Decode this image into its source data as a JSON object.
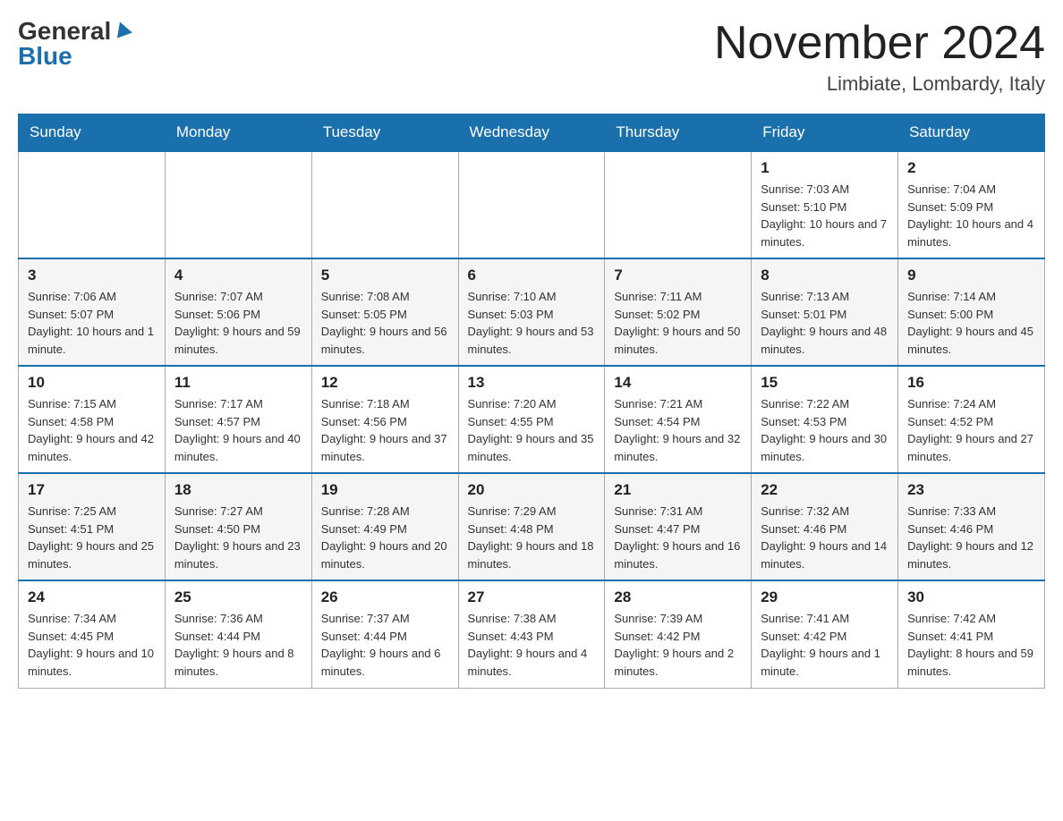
{
  "logo": {
    "general": "General",
    "blue": "Blue"
  },
  "title": "November 2024",
  "location": "Limbiate, Lombardy, Italy",
  "days_of_week": [
    "Sunday",
    "Monday",
    "Tuesday",
    "Wednesday",
    "Thursday",
    "Friday",
    "Saturday"
  ],
  "weeks": [
    [
      {
        "day": "",
        "info": ""
      },
      {
        "day": "",
        "info": ""
      },
      {
        "day": "",
        "info": ""
      },
      {
        "day": "",
        "info": ""
      },
      {
        "day": "",
        "info": ""
      },
      {
        "day": "1",
        "info": "Sunrise: 7:03 AM\nSunset: 5:10 PM\nDaylight: 10 hours and 7 minutes."
      },
      {
        "day": "2",
        "info": "Sunrise: 7:04 AM\nSunset: 5:09 PM\nDaylight: 10 hours and 4 minutes."
      }
    ],
    [
      {
        "day": "3",
        "info": "Sunrise: 7:06 AM\nSunset: 5:07 PM\nDaylight: 10 hours and 1 minute."
      },
      {
        "day": "4",
        "info": "Sunrise: 7:07 AM\nSunset: 5:06 PM\nDaylight: 9 hours and 59 minutes."
      },
      {
        "day": "5",
        "info": "Sunrise: 7:08 AM\nSunset: 5:05 PM\nDaylight: 9 hours and 56 minutes."
      },
      {
        "day": "6",
        "info": "Sunrise: 7:10 AM\nSunset: 5:03 PM\nDaylight: 9 hours and 53 minutes."
      },
      {
        "day": "7",
        "info": "Sunrise: 7:11 AM\nSunset: 5:02 PM\nDaylight: 9 hours and 50 minutes."
      },
      {
        "day": "8",
        "info": "Sunrise: 7:13 AM\nSunset: 5:01 PM\nDaylight: 9 hours and 48 minutes."
      },
      {
        "day": "9",
        "info": "Sunrise: 7:14 AM\nSunset: 5:00 PM\nDaylight: 9 hours and 45 minutes."
      }
    ],
    [
      {
        "day": "10",
        "info": "Sunrise: 7:15 AM\nSunset: 4:58 PM\nDaylight: 9 hours and 42 minutes."
      },
      {
        "day": "11",
        "info": "Sunrise: 7:17 AM\nSunset: 4:57 PM\nDaylight: 9 hours and 40 minutes."
      },
      {
        "day": "12",
        "info": "Sunrise: 7:18 AM\nSunset: 4:56 PM\nDaylight: 9 hours and 37 minutes."
      },
      {
        "day": "13",
        "info": "Sunrise: 7:20 AM\nSunset: 4:55 PM\nDaylight: 9 hours and 35 minutes."
      },
      {
        "day": "14",
        "info": "Sunrise: 7:21 AM\nSunset: 4:54 PM\nDaylight: 9 hours and 32 minutes."
      },
      {
        "day": "15",
        "info": "Sunrise: 7:22 AM\nSunset: 4:53 PM\nDaylight: 9 hours and 30 minutes."
      },
      {
        "day": "16",
        "info": "Sunrise: 7:24 AM\nSunset: 4:52 PM\nDaylight: 9 hours and 27 minutes."
      }
    ],
    [
      {
        "day": "17",
        "info": "Sunrise: 7:25 AM\nSunset: 4:51 PM\nDaylight: 9 hours and 25 minutes."
      },
      {
        "day": "18",
        "info": "Sunrise: 7:27 AM\nSunset: 4:50 PM\nDaylight: 9 hours and 23 minutes."
      },
      {
        "day": "19",
        "info": "Sunrise: 7:28 AM\nSunset: 4:49 PM\nDaylight: 9 hours and 20 minutes."
      },
      {
        "day": "20",
        "info": "Sunrise: 7:29 AM\nSunset: 4:48 PM\nDaylight: 9 hours and 18 minutes."
      },
      {
        "day": "21",
        "info": "Sunrise: 7:31 AM\nSunset: 4:47 PM\nDaylight: 9 hours and 16 minutes."
      },
      {
        "day": "22",
        "info": "Sunrise: 7:32 AM\nSunset: 4:46 PM\nDaylight: 9 hours and 14 minutes."
      },
      {
        "day": "23",
        "info": "Sunrise: 7:33 AM\nSunset: 4:46 PM\nDaylight: 9 hours and 12 minutes."
      }
    ],
    [
      {
        "day": "24",
        "info": "Sunrise: 7:34 AM\nSunset: 4:45 PM\nDaylight: 9 hours and 10 minutes."
      },
      {
        "day": "25",
        "info": "Sunrise: 7:36 AM\nSunset: 4:44 PM\nDaylight: 9 hours and 8 minutes."
      },
      {
        "day": "26",
        "info": "Sunrise: 7:37 AM\nSunset: 4:44 PM\nDaylight: 9 hours and 6 minutes."
      },
      {
        "day": "27",
        "info": "Sunrise: 7:38 AM\nSunset: 4:43 PM\nDaylight: 9 hours and 4 minutes."
      },
      {
        "day": "28",
        "info": "Sunrise: 7:39 AM\nSunset: 4:42 PM\nDaylight: 9 hours and 2 minutes."
      },
      {
        "day": "29",
        "info": "Sunrise: 7:41 AM\nSunset: 4:42 PM\nDaylight: 9 hours and 1 minute."
      },
      {
        "day": "30",
        "info": "Sunrise: 7:42 AM\nSunset: 4:41 PM\nDaylight: 8 hours and 59 minutes."
      }
    ]
  ]
}
